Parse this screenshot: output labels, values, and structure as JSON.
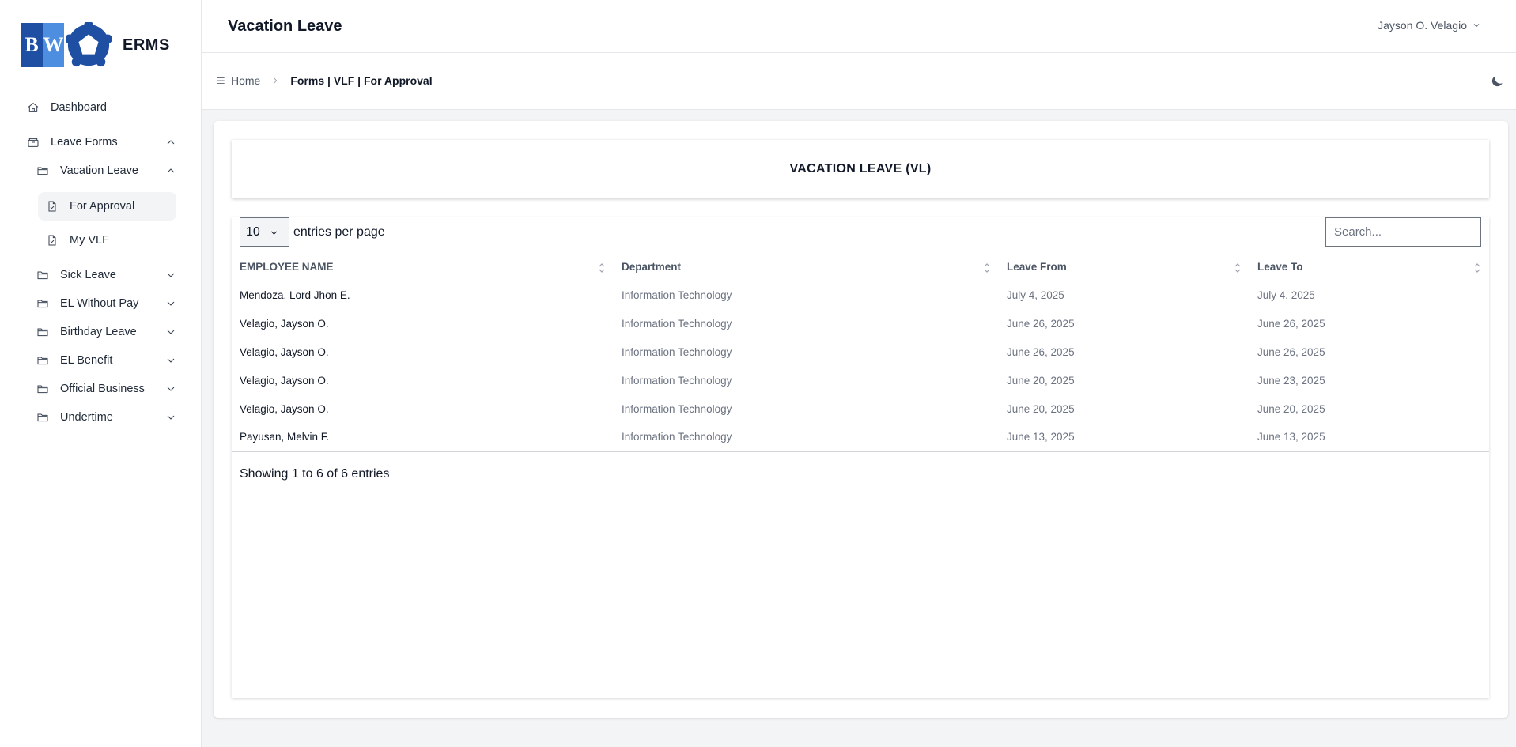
{
  "app": {
    "logo_letters": [
      "B",
      "W"
    ],
    "name": "ERMS"
  },
  "sidebar": {
    "items": [
      {
        "label": "Dashboard",
        "icon": "home-icon"
      },
      {
        "label": "Leave Forms",
        "icon": "archive-icon",
        "expanded": true
      },
      {
        "label": "Vacation Leave",
        "icon": "folder-icon",
        "expanded": true
      },
      {
        "label": "For Approval",
        "icon": "document-icon",
        "active": true
      },
      {
        "label": "My VLF",
        "icon": "document-icon"
      },
      {
        "label": "Sick Leave",
        "icon": "folder-icon"
      },
      {
        "label": "EL Without Pay",
        "icon": "folder-icon"
      },
      {
        "label": "Birthday Leave",
        "icon": "folder-icon"
      },
      {
        "label": "EL Benefit",
        "icon": "folder-icon"
      },
      {
        "label": "Official Business",
        "icon": "folder-icon"
      },
      {
        "label": "Undertime",
        "icon": "folder-icon"
      }
    ]
  },
  "header": {
    "title": "Vacation Leave",
    "user": "Jayson O. Velagio"
  },
  "breadcrumb": {
    "home": "Home",
    "current": "Forms | VLF | For Approval"
  },
  "main": {
    "card_title": "VACATION LEAVE (VL)",
    "per_page_value": "10",
    "per_page_label": "entries per page",
    "search_placeholder": "Search...",
    "columns": [
      "EMPLOYEE NAME",
      "Department",
      "Leave From",
      "Leave To"
    ],
    "rows": [
      [
        "Mendoza, Lord Jhon E.",
        "Information Technology",
        "July 4, 2025",
        "July 4, 2025"
      ],
      [
        "Velagio, Jayson O.",
        "Information Technology",
        "June 26, 2025",
        "June 26, 2025"
      ],
      [
        "Velagio, Jayson O.",
        "Information Technology",
        "June 26, 2025",
        "June 26, 2025"
      ],
      [
        "Velagio, Jayson O.",
        "Information Technology",
        "June 20, 2025",
        "June 23, 2025"
      ],
      [
        "Velagio, Jayson O.",
        "Information Technology",
        "June 20, 2025",
        "June 20, 2025"
      ],
      [
        "Payusan, Melvin F.",
        "Information Technology",
        "June 13, 2025",
        "June 13, 2025"
      ]
    ],
    "info": "Showing 1 to 6 of 6 entries"
  },
  "colors": {
    "logo_dark_blue": "#1e4fa3",
    "logo_light_blue": "#4d8ee0",
    "active_bg": "#f3f4f6"
  }
}
